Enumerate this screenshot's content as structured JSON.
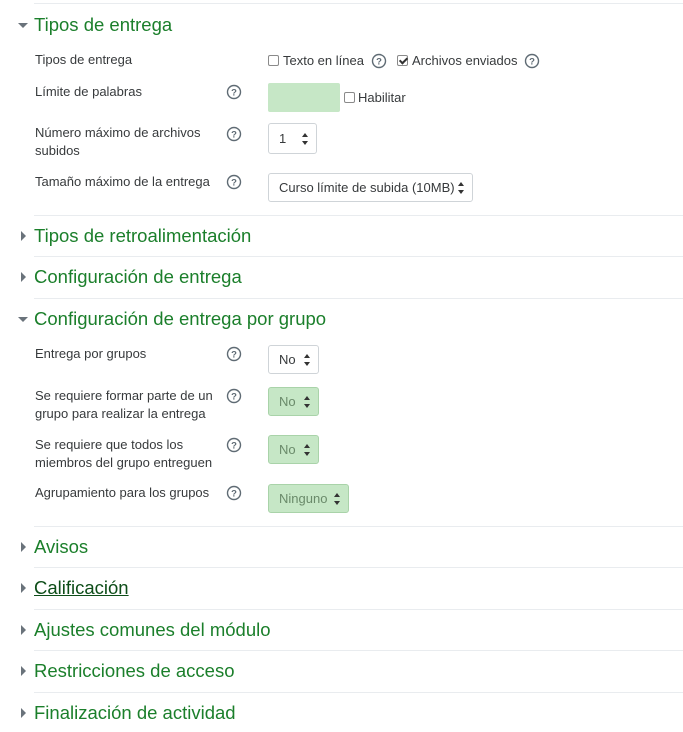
{
  "sections": {
    "tipos_entrega": {
      "title": "Tipos de entrega",
      "expanded": true
    },
    "tipos_retro": {
      "title": "Tipos de retroalimentación",
      "expanded": false
    },
    "config_entrega": {
      "title": "Configuración de entrega",
      "expanded": false
    },
    "config_grupo": {
      "title": "Configuración de entrega por grupo",
      "expanded": true
    },
    "avisos": {
      "title": "Avisos",
      "expanded": false
    },
    "calificacion": {
      "title": "Calificación",
      "expanded": false
    },
    "ajustes": {
      "title": "Ajustes comunes del módulo",
      "expanded": false
    },
    "restricciones": {
      "title": "Restricciones de acceso",
      "expanded": false
    },
    "finalizacion": {
      "title": "Finalización de actividad",
      "expanded": false
    }
  },
  "tipos_entrega_fields": {
    "tipos_label": "Tipos de entrega",
    "texto_en_linea": {
      "label": "Texto en línea",
      "checked": false
    },
    "archivos_enviados": {
      "label": "Archivos enviados",
      "checked": true
    },
    "limite_label": "Límite de palabras",
    "limite_value": "",
    "habilitar": {
      "label": "Habilitar",
      "checked": false
    },
    "num_archivos_label_1": "Número máximo de archivos",
    "num_archivos_label_2": "subidos",
    "num_archivos_value": "1",
    "tamano_label": "Tamaño máximo de la entrega",
    "tamano_value": "Curso límite de subida (10MB)"
  },
  "grupo_fields": {
    "entrega_grupos_label": "Entrega por grupos",
    "entrega_grupos_value": "No",
    "requiere_grupo_label_1": "Se requiere formar parte de un",
    "requiere_grupo_label_2": "grupo para realizar la entrega",
    "requiere_grupo_value": "No",
    "todos_miembros_label_1": "Se requiere que todos los",
    "todos_miembros_label_2": "miembros del grupo entreguen",
    "todos_miembros_value": "No",
    "agrupamiento_label": "Agrupamiento para los grupos",
    "agrupamiento_value": "Ninguno"
  },
  "colors": {
    "section_title": "#1b7f2b",
    "disabled_field": "#c6e7c6"
  },
  "icons": {
    "help": "question-circle-icon",
    "expanded": "caret-down-icon",
    "collapsed": "caret-right-icon"
  }
}
